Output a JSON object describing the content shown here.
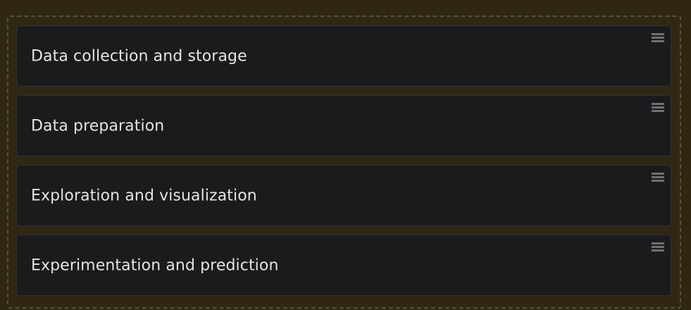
{
  "cards": [
    {
      "label": "Data collection and storage"
    },
    {
      "label": "Data preparation"
    },
    {
      "label": "Exploration and visualization"
    },
    {
      "label": "Experimentation and prediction"
    }
  ],
  "icons": {
    "drag_handle": "drag-handle-icon"
  },
  "colors": {
    "page_background": "#2f2714",
    "card_background": "#1a1b1d",
    "text": "#e4e4e1",
    "handle": "#6f7073"
  }
}
